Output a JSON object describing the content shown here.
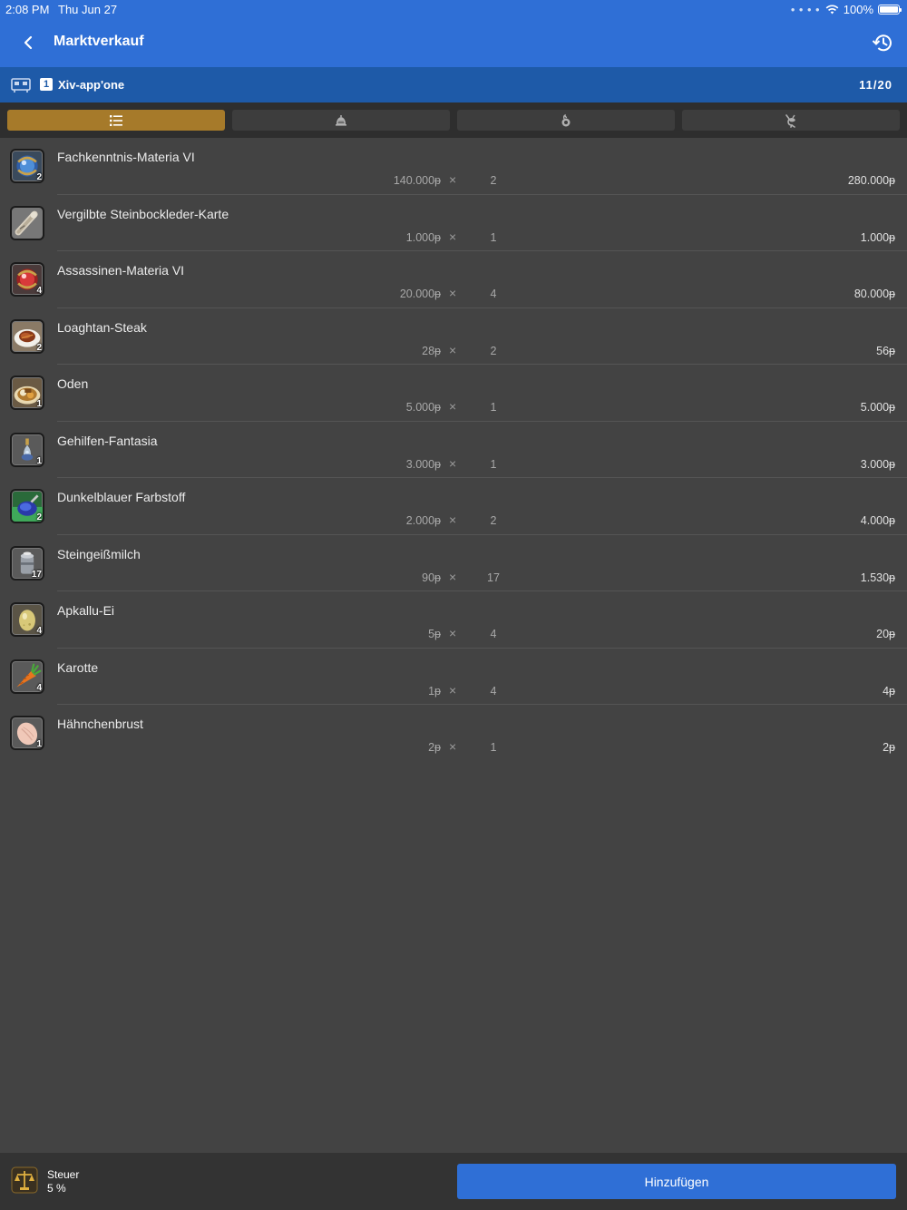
{
  "status_bar": {
    "time": "2:08 PM",
    "date": "Thu Jun 27",
    "battery": "100%"
  },
  "header": {
    "title": "Marktverkauf",
    "back_icon": "chevron-left-icon",
    "history_icon": "history-icon"
  },
  "retainer": {
    "index": "1",
    "name": "Xiv-app'one",
    "count": "11/20"
  },
  "tabs": [
    {
      "icon": "list-icon",
      "active": true
    },
    {
      "icon": "bell-icon",
      "active": false
    },
    {
      "icon": "food-icon",
      "active": false
    },
    {
      "icon": "chocobo-icon",
      "active": false
    }
  ],
  "items": [
    {
      "name": "Fachkenntnis-Materia VI",
      "badge": "2",
      "unit_price": "140.000ᵽ",
      "times": "×",
      "count": "2",
      "total": "280.000ᵽ",
      "icon": "materia-blue-icon"
    },
    {
      "name": "Vergilbte Steinbockleder-Karte",
      "badge": "",
      "unit_price": "1.000ᵽ",
      "times": "×",
      "count": "1",
      "total": "1.000ᵽ",
      "icon": "map-scroll-icon"
    },
    {
      "name": "Assassinen-Materia VI",
      "badge": "4",
      "unit_price": "20.000ᵽ",
      "times": "×",
      "count": "4",
      "total": "80.000ᵽ",
      "icon": "materia-red-icon"
    },
    {
      "name": "Loaghtan-Steak",
      "badge": "2",
      "unit_price": "28ᵽ",
      "times": "×",
      "count": "2",
      "total": "56ᵽ",
      "icon": "steak-icon"
    },
    {
      "name": "Oden",
      "badge": "1",
      "unit_price": "5.000ᵽ",
      "times": "×",
      "count": "1",
      "total": "5.000ᵽ",
      "icon": "oden-icon"
    },
    {
      "name": "Gehilfen-Fantasia",
      "badge": "1",
      "unit_price": "3.000ᵽ",
      "times": "×",
      "count": "1",
      "total": "3.000ᵽ",
      "icon": "potion-icon"
    },
    {
      "name": "Dunkelblauer Farbstoff",
      "badge": "2",
      "unit_price": "2.000ᵽ",
      "times": "×",
      "count": "2",
      "total": "4.000ᵽ",
      "icon": "dye-icon"
    },
    {
      "name": "Steingeißmilch",
      "badge": "17",
      "unit_price": "90ᵽ",
      "times": "×",
      "count": "17",
      "total": "1.530ᵽ",
      "icon": "milk-can-icon"
    },
    {
      "name": "Apkallu-Ei",
      "badge": "4",
      "unit_price": "5ᵽ",
      "times": "×",
      "count": "4",
      "total": "20ᵽ",
      "icon": "egg-icon"
    },
    {
      "name": "Karotte",
      "badge": "4",
      "unit_price": "1ᵽ",
      "times": "×",
      "count": "4",
      "total": "4ᵽ",
      "icon": "carrot-icon"
    },
    {
      "name": "Hähnchenbrust",
      "badge": "1",
      "unit_price": "2ᵽ",
      "times": "×",
      "count": "1",
      "total": "2ᵽ",
      "icon": "chicken-breast-icon"
    }
  ],
  "footer": {
    "tax_label": "Steuer",
    "tax_value": "5 %",
    "add_label": "Hinzufügen",
    "tax_icon": "scales-icon"
  },
  "colors": {
    "accent": "#2f6fd6",
    "retainer_bar": "#1e5aa8",
    "active_tab": "#a67a2a",
    "background": "#434343"
  }
}
